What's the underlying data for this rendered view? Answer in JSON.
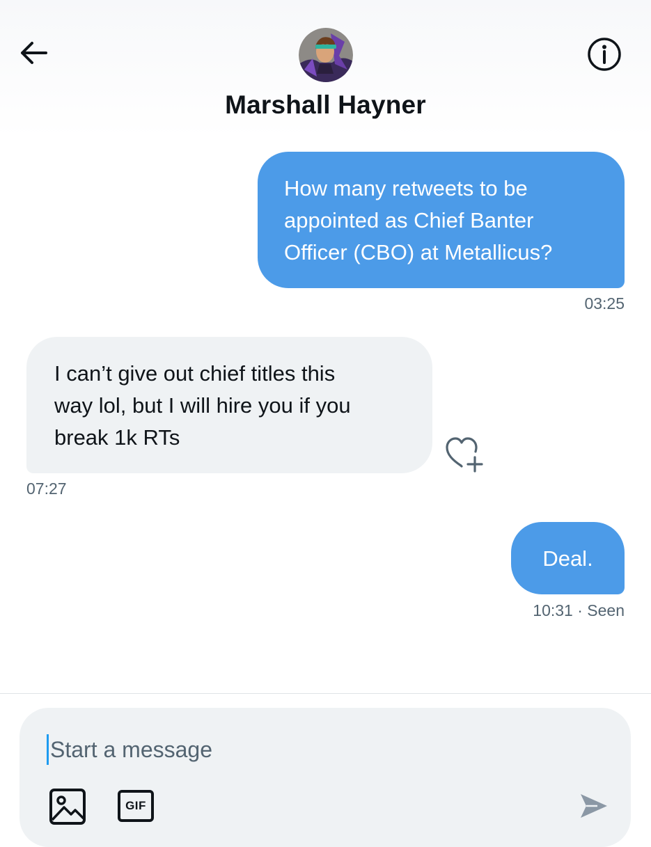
{
  "header": {
    "contact_name": "Marshall Hayner",
    "back_icon": "arrow-left-icon",
    "info_icon": "info-icon"
  },
  "messages": [
    {
      "direction": "outgoing",
      "lines": [
        "How many retweets to be",
        "appointed as Chief Banter",
        "Officer (CBO) at Metallicus?"
      ],
      "time": "03:25"
    },
    {
      "direction": "incoming",
      "lines": [
        "I can’t give out chief titles this",
        "way lol, but I will hire you if you",
        "break 1k RTs"
      ],
      "time": "07:27",
      "reaction_icon": "heart-plus-icon"
    },
    {
      "direction": "outgoing",
      "lines": [
        "Deal."
      ],
      "time": "10:31 · Seen"
    }
  ],
  "composer": {
    "placeholder": "Start a message",
    "value": "",
    "gif_label": "GIF",
    "media_icon": "image-icon",
    "send_icon": "send-icon"
  },
  "colors": {
    "outgoing_bubble": "#4c9be8",
    "incoming_bubble": "#eff2f4",
    "timestamp": "#536471",
    "cursor": "#1d9bf0"
  }
}
